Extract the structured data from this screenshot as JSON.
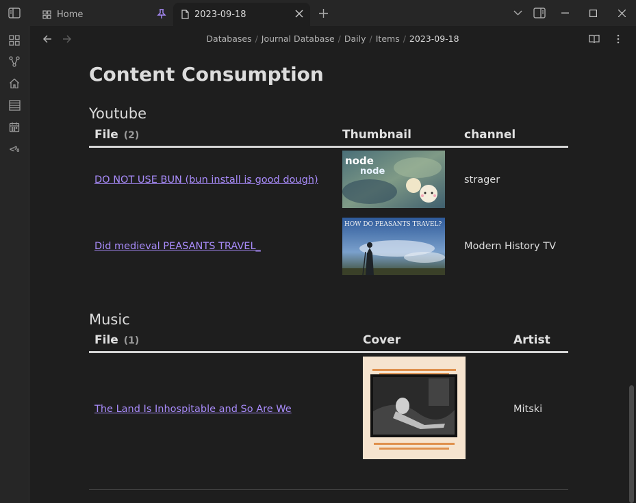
{
  "window": {
    "tabs": [
      {
        "label": "Home",
        "active": false,
        "pinned": true
      },
      {
        "label": "2023-09-18",
        "active": true
      }
    ],
    "icons": {
      "sidebar_toggle": "sidebar-toggle-icon",
      "new_tab": "plus-icon",
      "tab_list": "chevron-down-icon",
      "right_sidebar": "right-sidebar-icon",
      "minimize": "minimize-icon",
      "maximize": "maximize-icon",
      "close": "close-icon"
    }
  },
  "ribbon": {
    "items": [
      "blocks-icon",
      "graph-icon",
      "home-icon",
      "list-icon",
      "calendar-icon",
      "template-icon"
    ],
    "template_glyph": "<%"
  },
  "nav": {
    "breadcrumb": [
      "Databases",
      "Journal Database",
      "Daily",
      "Items"
    ],
    "breadcrumb_current": "2023-09-18",
    "separator": "/"
  },
  "page": {
    "title": "Content Consumption",
    "youtube": {
      "heading": "Youtube",
      "headers": {
        "file": "File",
        "count": "(2)",
        "thumbnail": "Thumbnail",
        "channel": "channel"
      },
      "rows": [
        {
          "file": "DO NOT USE BUN (bun install is good dough)",
          "channel": "strager"
        },
        {
          "file": "Did medieval PEASANTS TRAVEL_",
          "channel": "Modern History TV",
          "thumb_caption": "HOW DO PEASANTS TRAVEL?"
        }
      ]
    },
    "music": {
      "heading": "Music",
      "headers": {
        "file": "File",
        "count": "(1)",
        "cover": "Cover",
        "artist": "Artist"
      },
      "rows": [
        {
          "file": "The Land Is Inhospitable and So Are We",
          "artist": "Mitski"
        }
      ]
    }
  },
  "colors": {
    "accent": "#a88bfa",
    "background": "#1e1e1e",
    "chrome": "#262626",
    "text": "#dcdcdc"
  }
}
